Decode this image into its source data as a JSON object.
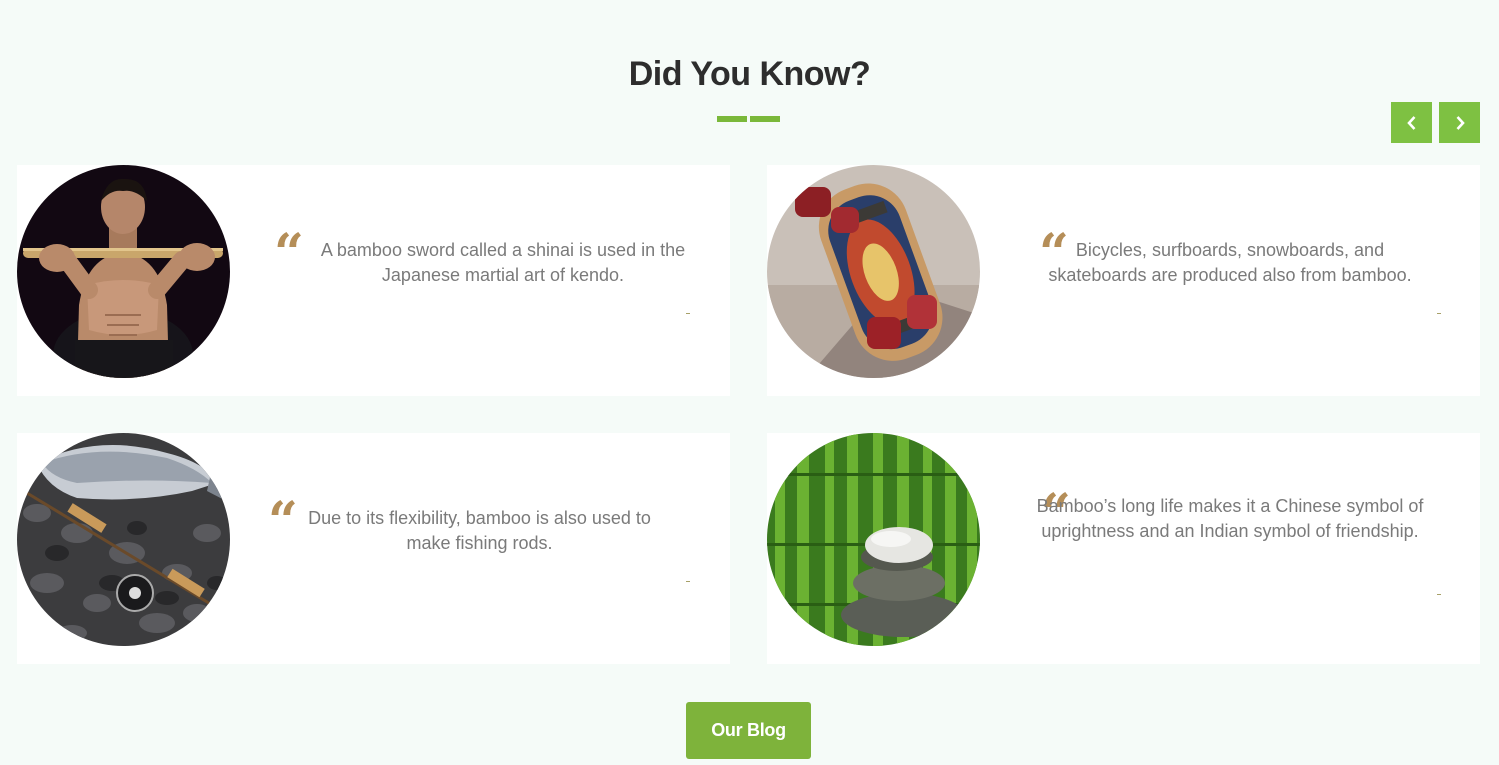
{
  "section": {
    "title": "Did You Know?"
  },
  "navigation": {
    "prev_icon": "chevron-left-icon",
    "next_icon": "chevron-right-icon",
    "accent_color": "#7ec142"
  },
  "facts": [
    {
      "image": "kendo-man-with-bamboo-sword",
      "text": "A bamboo sword called a shinai is used in the Japanese martial art of kendo.",
      "author": "-"
    },
    {
      "image": "skateboard-on-pavement",
      "text": "Bicycles, surfboards, snowboards, and skateboards are produced also from bamboo.",
      "author": "-"
    },
    {
      "image": "fish-and-fishing-rod-on-stones",
      "text": "Due to its flexibility, bamboo is also used to make fishing rods.",
      "author": "-"
    },
    {
      "image": "stacked-stones-with-bamboo",
      "text": "Bamboo’s long life makes it a Chinese symbol of uprightness and an Indian symbol of friendship.",
      "author": "-"
    }
  ],
  "colors": {
    "background": "#f5fbf8",
    "quote_mark": "#b58e58",
    "button": "#7eb33b"
  },
  "blog_button": {
    "label": "Our Blog"
  }
}
